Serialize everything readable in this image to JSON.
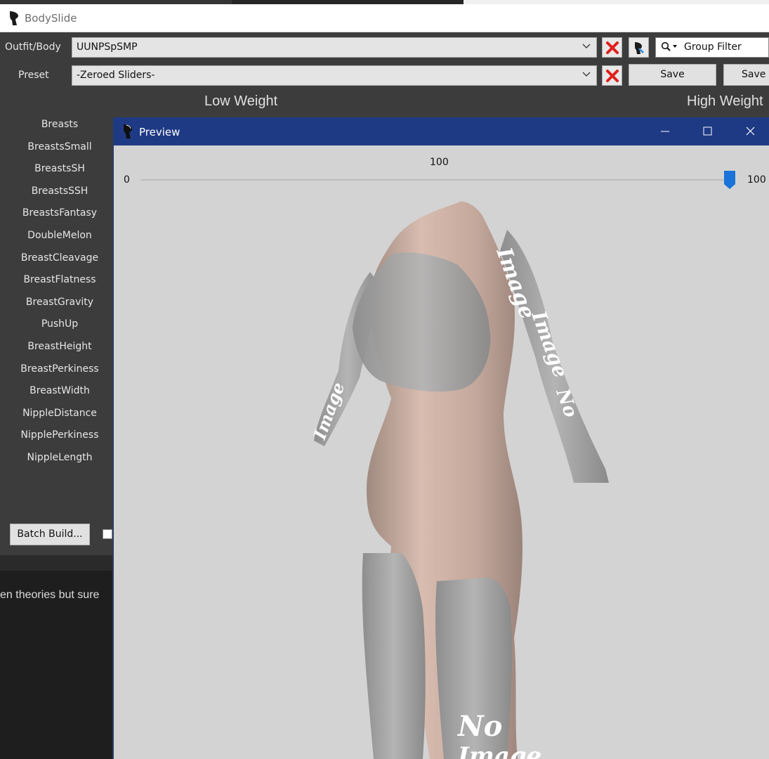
{
  "app": {
    "title": "BodySlide"
  },
  "toolbar": {
    "outfit_label": "Outfit/Body",
    "outfit_value": "UUNPSpSMP",
    "preset_label": "Preset",
    "preset_value": "-Zeroed Sliders-",
    "group_filter_placeholder": "Group Filter",
    "save_label": "Save",
    "save_as_label": "Save A"
  },
  "headers": {
    "low_weight": "Low Weight",
    "high_weight": "High Weight"
  },
  "sliders": [
    "Breasts",
    "BreastsSmall",
    "BreastsSH",
    "BreastsSSH",
    "BreastsFantasy",
    "DoubleMelon",
    "BreastCleavage",
    "BreastFlatness",
    "BreastGravity",
    "PushUp",
    "BreastHeight",
    "BreastPerkiness",
    "BreastWidth",
    "NippleDistance",
    "NipplePerkiness",
    "NippleLength"
  ],
  "bottom": {
    "batch_build_label": "Batch Build..."
  },
  "underlying": {
    "text": "en theories but sure"
  },
  "preview": {
    "title": "Preview",
    "weight_min": "0",
    "weight_current": "100",
    "weight_max": "100",
    "weight_fraction": 1.0
  },
  "colors": {
    "accent": "#1f3a84",
    "slider_thumb": "#1a73d9",
    "delete_red": "#e0201c",
    "dark_bg": "#3c3c3c",
    "preview_bg": "#d3d3d3"
  },
  "icons": {
    "app": "bodyslide-logo-icon",
    "clear": "red-x-icon",
    "outfit_studio": "outfit-studio-icon",
    "search": "search-icon",
    "dropdown": "chevron-down-icon"
  }
}
